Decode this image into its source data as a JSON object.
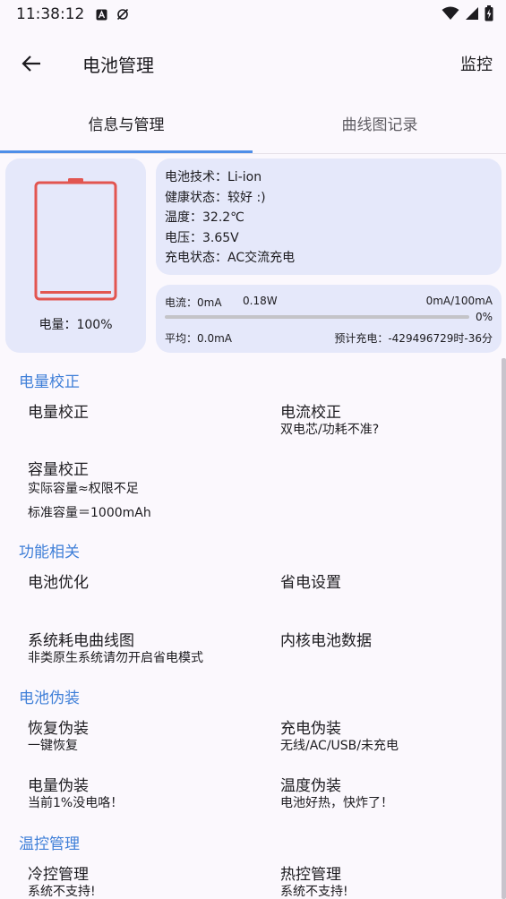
{
  "status_bar": {
    "time": "11:38:12"
  },
  "app_bar": {
    "title": "电池管理",
    "action": "监控"
  },
  "tabs": [
    {
      "label": "信息与管理"
    },
    {
      "label": "曲线图记录"
    }
  ],
  "battery": {
    "level_label": "电量：100%",
    "level": 1.0,
    "color": "#e25550"
  },
  "info": [
    "电池技术：Li-ion",
    "健康状态：较好 :)",
    "温度：32.2℃",
    "电压：3.65V",
    "充电状态：AC交流充电"
  ],
  "current": {
    "current": "电流：0mA",
    "power": "0.18W",
    "ratio": "0mA/100mA",
    "percent": "0%",
    "progress": 0,
    "average": "平均：0.0mA",
    "estimate": "预计充电：-429496729时-36分"
  },
  "sections": [
    {
      "title": "电量校正",
      "items": [
        {
          "title": "电量校正",
          "sub": ""
        },
        {
          "title": "电流校正",
          "sub": "双电芯/功耗不准?"
        },
        {
          "title": "容量校正",
          "sub": "实际容量≈权限不足",
          "sub2": "标准容量＝1000mAh"
        }
      ]
    },
    {
      "title": "功能相关",
      "items": [
        {
          "title": "电池优化",
          "sub": ""
        },
        {
          "title": "省电设置",
          "sub": ""
        },
        {
          "title": "系统耗电曲线图",
          "sub": "非类原生系统请勿开启省电模式"
        },
        {
          "title": "内核电池数据",
          "sub": ""
        }
      ]
    },
    {
      "title": "电池伪装",
      "items": [
        {
          "title": "恢复伪装",
          "sub": "一键恢复"
        },
        {
          "title": "充电伪装",
          "sub": "无线/AC/USB/未充电"
        },
        {
          "title": "电量伪装",
          "sub": "当前1%没电咯！"
        },
        {
          "title": "温度伪装",
          "sub": "电池好热，快炸了！"
        }
      ]
    },
    {
      "title": "温控管理",
      "items": [
        {
          "title": "冷控管理",
          "sub": "系统不支持!"
        },
        {
          "title": "热控管理",
          "sub": "系统不支持!"
        }
      ]
    }
  ],
  "colors": {
    "accent": "#4e8ee8",
    "section": "#3f7fd8",
    "card": "#e5e8fa",
    "battery": "#e25550"
  }
}
